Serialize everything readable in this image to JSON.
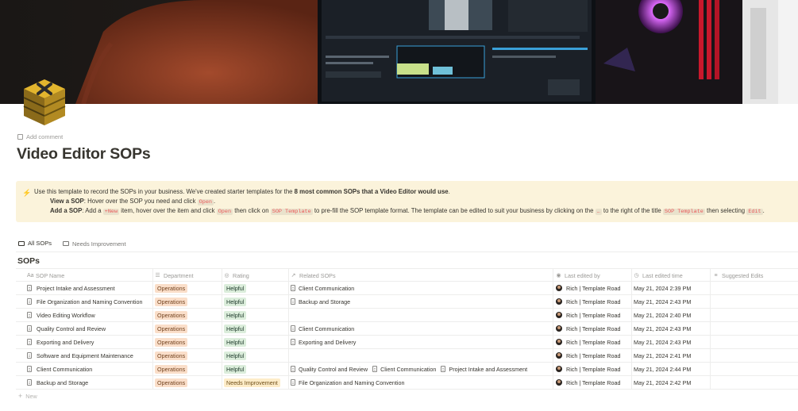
{
  "page": {
    "title": "Video Editor SOPs",
    "add_comment_label": "Add comment",
    "icon": "gold-cube-icon"
  },
  "callout": {
    "icon": "lightning-bolt-icon",
    "line1_pre": "Use this template to record the SOPs in your business. We've created starter templates for the ",
    "line1_bold": "8 most common SOPs that a Video Editor would use",
    "line1_post": ".",
    "line2_bold": "View a SOP",
    "line2_pre": ": Hover over the SOP you need and click ",
    "line2_code": "Open",
    "line2_post": ".",
    "line3_bold": "Add a SOP",
    "line3_a": ": Add a ",
    "line3_code1": "+New",
    "line3_b": " item, hover over the item and click ",
    "line3_code2": "Open",
    "line3_c": " then click on ",
    "line3_code3": "SOP Template",
    "line3_d": " to pre-fill the SOP template format. The template can be edited to suit your business by clicking on the ",
    "line3_code4": "…",
    "line3_e": " to the right of the title ",
    "line3_code5": "SOP Template",
    "line3_f": " then selecting ",
    "line3_code6": "Edit",
    "line3_g": "."
  },
  "tabs": [
    {
      "label": "All SOPs",
      "active": true
    },
    {
      "label": "Needs Improvement",
      "active": false
    }
  ],
  "database": {
    "title": "SOPs",
    "columns": {
      "name": "SOP Name",
      "department": "Department",
      "rating": "Rating",
      "related": "Related SOPs",
      "last_edited_by": "Last edited by",
      "last_edited_time": "Last edited time",
      "suggested": "Suggested Edits"
    },
    "new_label": "New",
    "rows": [
      {
        "name": "Project Intake and Assessment",
        "department": "Operations",
        "rating": "Helpful",
        "related": [
          "Client Communication"
        ],
        "edited_by": "Rich | Template Road",
        "edited_time": "May 21, 2024 2:39 PM"
      },
      {
        "name": "File Organization and Naming Convention",
        "department": "Operations",
        "rating": "Helpful",
        "related": [
          "Backup and Storage"
        ],
        "edited_by": "Rich | Template Road",
        "edited_time": "May 21, 2024 2:43 PM"
      },
      {
        "name": "Video Editing Workflow",
        "department": "Operations",
        "rating": "Helpful",
        "related": [],
        "edited_by": "Rich | Template Road",
        "edited_time": "May 21, 2024 2:40 PM"
      },
      {
        "name": "Quality Control and Review",
        "department": "Operations",
        "rating": "Helpful",
        "related": [
          "Client Communication"
        ],
        "edited_by": "Rich | Template Road",
        "edited_time": "May 21, 2024 2:43 PM"
      },
      {
        "name": "Exporting and Delivery",
        "department": "Operations",
        "rating": "Helpful",
        "related": [
          "Exporting and Delivery"
        ],
        "edited_by": "Rich | Template Road",
        "edited_time": "May 21, 2024 2:43 PM"
      },
      {
        "name": "Software and Equipment Maintenance",
        "department": "Operations",
        "rating": "Helpful",
        "related": [],
        "edited_by": "Rich | Template Road",
        "edited_time": "May 21, 2024 2:41 PM"
      },
      {
        "name": "Client Communication",
        "department": "Operations",
        "rating": "Helpful",
        "related": [
          "Quality Control and Review",
          "Client Communication",
          "Project Intake and Assessment"
        ],
        "edited_by": "Rich | Template Road",
        "edited_time": "May 21, 2024 2:44 PM"
      },
      {
        "name": "Backup and Storage",
        "department": "Operations",
        "rating": "Needs Improvement",
        "related": [
          "File Organization and Naming Convention"
        ],
        "edited_by": "Rich | Template Road",
        "edited_time": "May 21, 2024 2:42 PM"
      }
    ]
  },
  "colors": {
    "callout_bg": "#fbf3db",
    "tag_operations": "#fadec9",
    "tag_helpful": "#dbeddb",
    "tag_needs_improvement": "#fdecc8"
  }
}
